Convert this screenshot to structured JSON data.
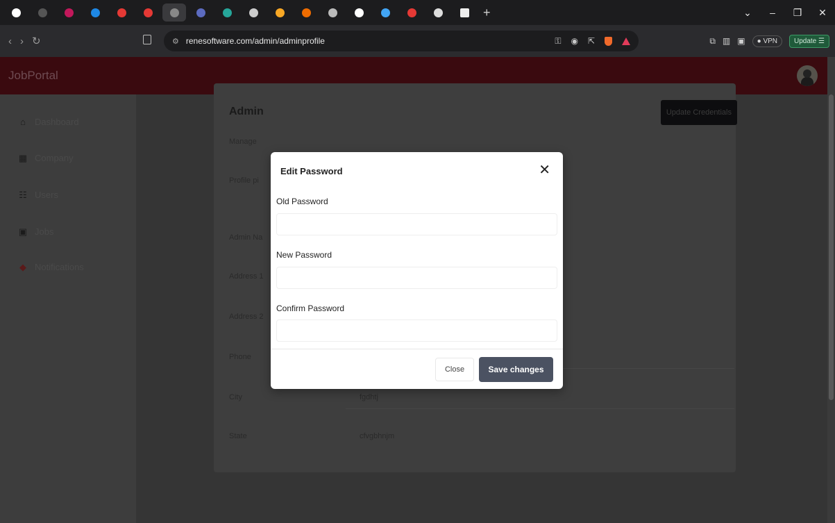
{
  "browser": {
    "url": "renesoftware.com/admin/adminprofile",
    "update_label": "Update",
    "vpn_label": "VPN"
  },
  "app": {
    "brand": "JobPortal",
    "sidebar": [
      {
        "label": "Dashboard",
        "icon": "home-icon"
      },
      {
        "label": "Company",
        "icon": "company-icon"
      },
      {
        "label": "Users",
        "icon": "users-icon"
      },
      {
        "label": "Jobs",
        "icon": "jobs-icon"
      },
      {
        "label": "Notifications",
        "icon": "bell-icon"
      }
    ],
    "card_title_partial": "Admin",
    "update_credentials": "Update Credentials",
    "fields": [
      {
        "label": "Manage"
      },
      {
        "label": "Profile pi"
      },
      {
        "label": "Admin Na"
      },
      {
        "label": "Address 1"
      },
      {
        "label": "Address 2"
      },
      {
        "label": "Phone",
        "value": "sgfdg"
      },
      {
        "label": "City",
        "value": "fgdhtj"
      },
      {
        "label": "State",
        "value": "cfvgbhnjm"
      }
    ]
  },
  "modal": {
    "title": "Edit Password",
    "old_label": "Old Password",
    "new_label": "New Password",
    "confirm_label": "Confirm Password",
    "close_label": "Close",
    "save_label": "Save changes"
  }
}
